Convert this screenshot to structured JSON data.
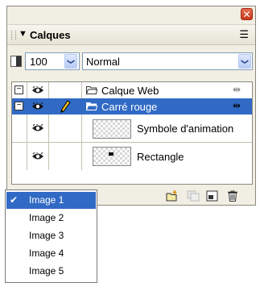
{
  "panel": {
    "close_glyph": "✕",
    "title": "Calques",
    "collapse_glyph": "▼",
    "menu_glyph": "☰"
  },
  "toolbar": {
    "opacity_value": "100",
    "blend_mode": "Normal",
    "dropdown_glyph": "❯"
  },
  "layers": [
    {
      "label": "Calque Web",
      "expander": "−",
      "web_glyph": "⇹",
      "selected": false
    },
    {
      "label": "Carré rouge",
      "expander": "−",
      "web_glyph": "⇹",
      "selected": true,
      "editable_icon": "pencil-icon"
    }
  ],
  "objects": [
    {
      "label": "Symbole d'animation",
      "thumb": "checkerboard"
    },
    {
      "label": "Rectangle",
      "thumb": "checkerboard-with-rect"
    }
  ],
  "frames_menu": {
    "check_glyph": "✔",
    "items": [
      "Image 1",
      "Image 2",
      "Image 3",
      "Image 4",
      "Image 5"
    ],
    "selected_index": 0
  },
  "bottom_icons": [
    "new-sublayer-icon",
    "duplicate-layer-icon",
    "add-mask-icon",
    "trash-icon"
  ],
  "colors": {
    "selection": "#316ac5",
    "panel_bg": "#f1eee3",
    "close_red": "#d24a2e"
  }
}
